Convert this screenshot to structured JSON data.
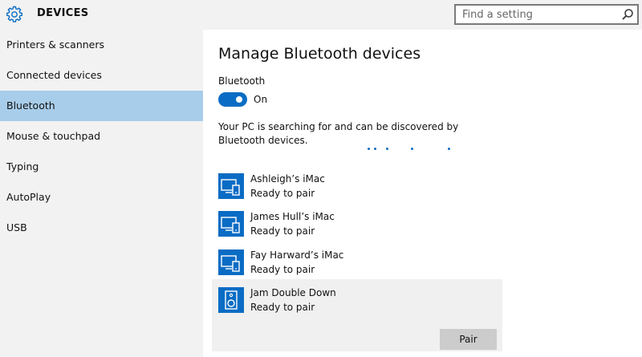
{
  "header": {
    "title": "DEVICES",
    "search_placeholder": "Find a setting"
  },
  "sidebar": {
    "items": [
      {
        "label": "Printers & scanners"
      },
      {
        "label": "Connected devices"
      },
      {
        "label": "Bluetooth",
        "selected": true
      },
      {
        "label": "Mouse & touchpad"
      },
      {
        "label": "Typing"
      },
      {
        "label": "AutoPlay"
      },
      {
        "label": "USB"
      }
    ]
  },
  "main": {
    "title": "Manage Bluetooth devices",
    "bluetooth_label": "Bluetooth",
    "toggle_state": "On",
    "status_text": "Your PC is searching for and can be discovered by Bluetooth devices.",
    "devices": [
      {
        "name": "Ashleigh’s iMac",
        "status": "Ready to pair",
        "icon": "computer-phone-icon"
      },
      {
        "name": "James Hull’s iMac",
        "status": "Ready to pair",
        "icon": "computer-phone-icon"
      },
      {
        "name": "Fay Harward’s iMac",
        "status": "Ready to pair",
        "icon": "computer-phone-icon"
      },
      {
        "name": "Jam Double Down",
        "status": "Ready to pair",
        "icon": "speaker-icon",
        "selected": true
      }
    ],
    "pair_label": "Pair"
  },
  "colors": {
    "accent": "#0a6cc4",
    "selected_nav": "#a8cdea",
    "sidebar_bg": "#f2f2f2"
  }
}
